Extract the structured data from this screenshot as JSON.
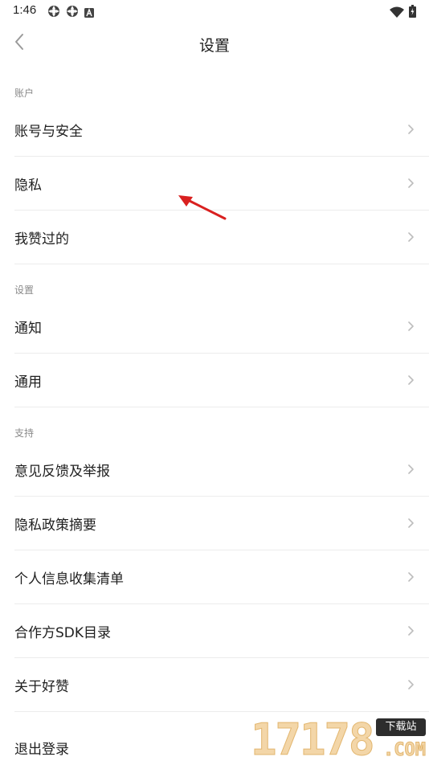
{
  "status_bar": {
    "time": "1:46",
    "left_icons": [
      "gear-icon",
      "gear-icon",
      "notification-a-icon"
    ],
    "right_icons": [
      "wifi-icon",
      "battery-icon"
    ]
  },
  "header": {
    "title": "设置",
    "back_icon": "chevron-left-icon"
  },
  "sections": [
    {
      "title": "账户",
      "items": [
        {
          "label": "账号与安全"
        },
        {
          "label": "隐私"
        },
        {
          "label": "我赞过的"
        }
      ]
    },
    {
      "title": "设置",
      "items": [
        {
          "label": "通知"
        },
        {
          "label": "通用"
        }
      ]
    },
    {
      "title": "支持",
      "items": [
        {
          "label": "意见反馈及举报"
        },
        {
          "label": "隐私政策摘要"
        },
        {
          "label": "个人信息收集清单"
        },
        {
          "label": "合作方SDK目录"
        },
        {
          "label": "关于好赞"
        }
      ]
    }
  ],
  "logout": {
    "label": "退出登录"
  },
  "watermark": {
    "digits": "17178",
    "badge": "下载站",
    "suffix": ".COM"
  },
  "colors": {
    "annotation_arrow": "#d9201f",
    "divider": "#ececec",
    "section_header": "#8a8a8a",
    "chevron": "#bdbdbd"
  }
}
